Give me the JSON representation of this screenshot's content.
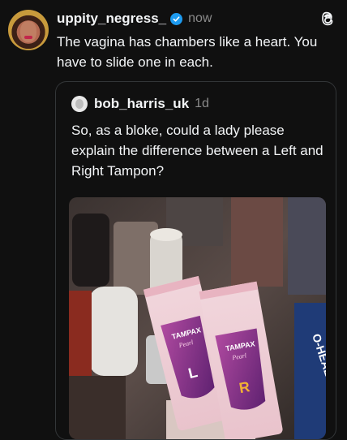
{
  "post": {
    "username": "uppity_negress_",
    "time": "now",
    "text": "The vagina has chambers like a heart. You have to slide one in each.",
    "avatar_icon": "profile-photo",
    "verified_icon": "verified-badge-icon",
    "app_icon": "threads-logo-icon",
    "accent_color": "#1d9bf0"
  },
  "quoted": {
    "username": "bob_harris_uk",
    "time": "1d",
    "text": "So, as a bloke, could a lady please explain the difference between a Left and Right Tampon?",
    "image": {
      "brand_left": "TAMPAX",
      "script_left": "Pearl",
      "letter_left": "L",
      "brand_right": "TAMPAX",
      "script_right": "Pearl",
      "letter_right": "R",
      "side_box_text": "O-HEAL"
    }
  }
}
